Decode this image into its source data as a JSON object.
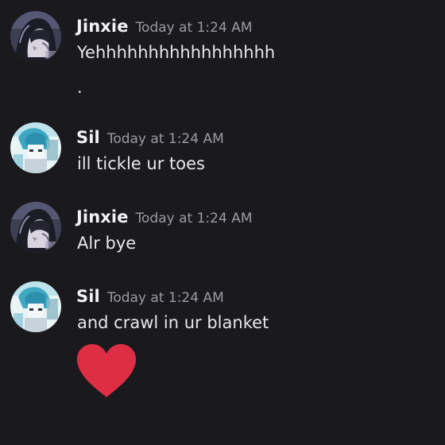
{
  "messages": [
    {
      "author": "Jinxie",
      "time": "Today at 1:24 AM",
      "lines": [
        "Yehhhhhhhhhhhhhhhhh",
        "."
      ],
      "avatar": "avatar-jinxie"
    },
    {
      "author": "Sil",
      "time": "Today at 1:24 AM",
      "lines": [
        "ill tickle ur toes"
      ],
      "avatar": "avatar-sil"
    },
    {
      "author": "Jinxie",
      "time": "Today at 1:24 AM",
      "lines": [
        "Alr bye"
      ],
      "avatar": "avatar-jinxie"
    },
    {
      "author": "Sil",
      "time": "Today at 1:24 AM",
      "lines": [
        "and crawl in ur blanket"
      ],
      "emoji": "heart-emoji",
      "avatar": "avatar-sil"
    }
  ],
  "colors": {
    "background": "#1a1a1e",
    "username": "#f2f2f5",
    "timestamp": "#9a9ba3",
    "text": "#e8e8ec",
    "heart": "#dd2e44"
  }
}
